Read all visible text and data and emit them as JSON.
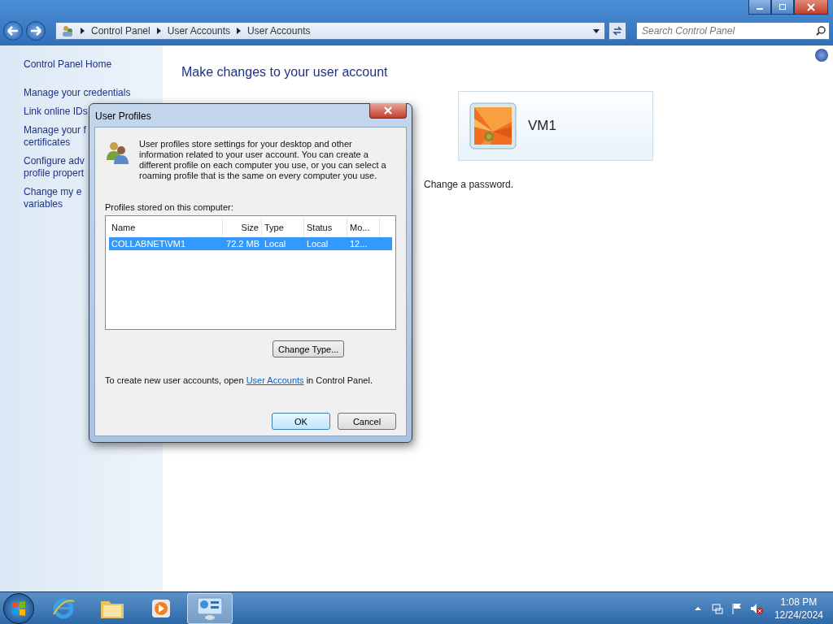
{
  "window": {
    "breadcrumb": [
      "Control Panel",
      "User Accounts",
      "User Accounts"
    ],
    "search": {
      "placeholder": "Search Control Panel"
    }
  },
  "sidebar": {
    "home": "Control Panel Home",
    "links": [
      {
        "lines": [
          "Manage your credentials"
        ]
      },
      {
        "lines": [
          "Link online IDs"
        ]
      },
      {
        "lines": [
          "Manage your f",
          "certificates"
        ]
      },
      {
        "lines": [
          "Configure adv",
          "profile propert"
        ]
      },
      {
        "lines": [
          "Change my e",
          "variables"
        ]
      }
    ]
  },
  "main": {
    "heading": "Make changes to your user account",
    "account": {
      "name": "VM1"
    },
    "note": "Change a password."
  },
  "dialog": {
    "title": "User Profiles",
    "description": "User profiles store settings for your desktop and other information related to your user account. You can create a different profile on each computer you use, or you can select a roaming profile that is the same on every computer you use.",
    "list_label": "Profiles stored on this computer:",
    "columns": [
      "Name",
      "Size",
      "Type",
      "Status",
      "Mo..."
    ],
    "rows": [
      {
        "cells": [
          "COLLABNET\\VM1",
          "72.2 MB",
          "Local",
          "Local",
          "12..."
        ],
        "selected": true
      }
    ],
    "change_type": "Change Type...",
    "footer": {
      "before": "To create new user accounts, open ",
      "link": "User Accounts",
      "after": " in Control Panel."
    },
    "buttons": [
      {
        "label": "OK",
        "kind": "default"
      },
      {
        "label": "Cancel",
        "kind": "normal"
      }
    ]
  },
  "taskbar": {
    "apps": [
      {
        "kind": "ie",
        "selected": false
      },
      {
        "kind": "folder",
        "selected": false
      },
      {
        "kind": "media",
        "selected": false
      },
      {
        "kind": "control-panel",
        "selected": true
      }
    ],
    "time": "1:08 PM",
    "date": "12/24/2024"
  }
}
